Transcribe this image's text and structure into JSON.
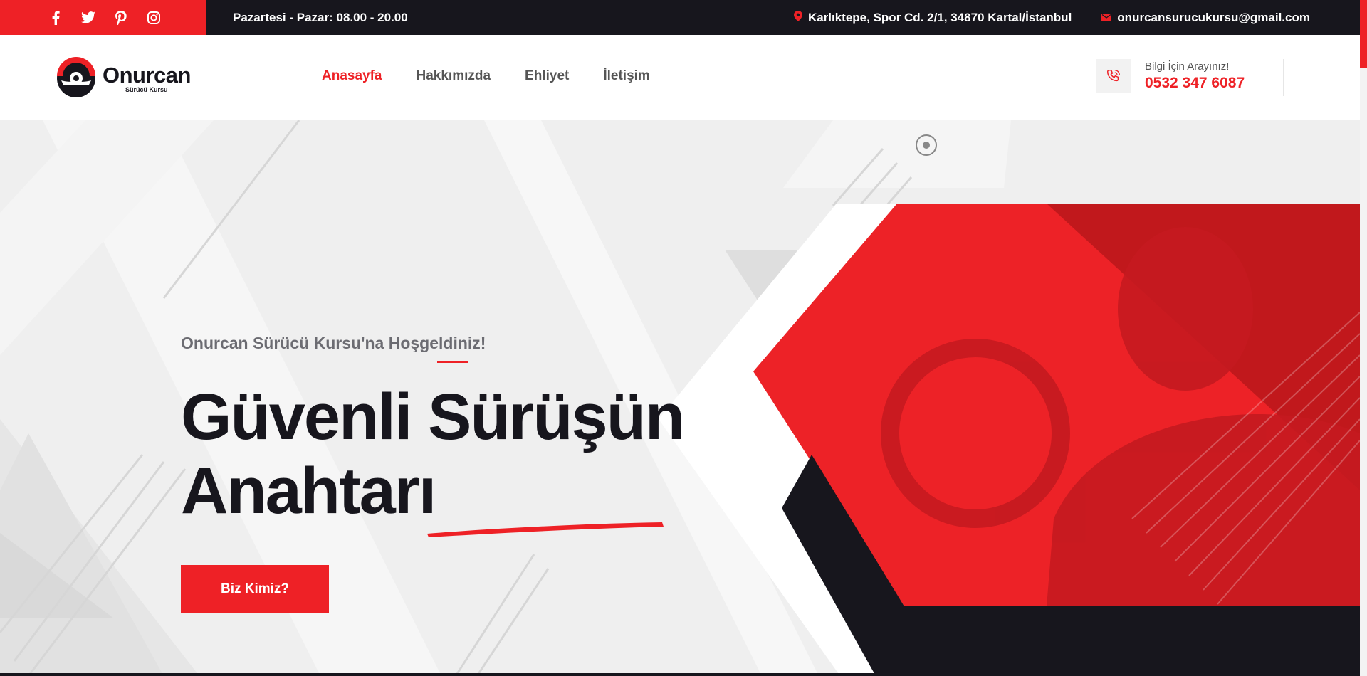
{
  "topbar": {
    "social": [
      "facebook-icon",
      "twitter-icon",
      "pinterest-icon",
      "instagram-icon"
    ],
    "hours": "Pazartesi - Pazar: 08.00 - 20.00",
    "address": "Karlıktepe, Spor Cd. 2/1, 34870 Kartal/İstanbul",
    "email": "onurcansurucukursu@gmail.com"
  },
  "header": {
    "brand": "Onurcan",
    "tagline": "Sürücü Kursu",
    "nav": [
      "Anasayfa",
      "Hakkımızda",
      "Ehliyet",
      "İletişim"
    ],
    "active_nav": "Anasayfa",
    "call_label": "Bilgi İçin Arayınız!",
    "phone": "0532 347 6087"
  },
  "hero": {
    "welcome": "Onurcan Sürücü Kursu'na Hoşgeldiniz!",
    "title_line1": "Güvenli Sürüşün",
    "title_line2": "Anahtarı",
    "cta": "Biz Kimiz?"
  },
  "colors": {
    "accent": "#ee2126",
    "dark": "#17161d",
    "hero_bg": "#efefef"
  }
}
